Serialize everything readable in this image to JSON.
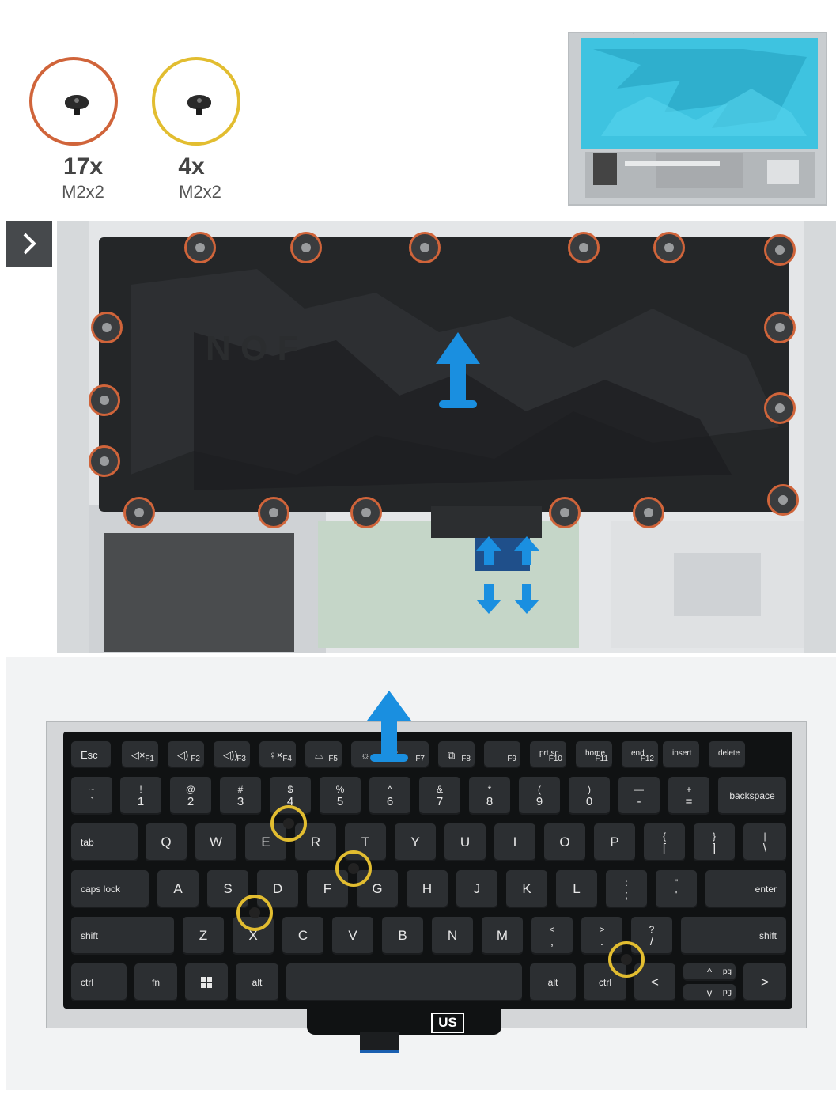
{
  "screws": [
    {
      "qty": "17x",
      "size": "M2x2",
      "ring_color": "#d0643a"
    },
    {
      "qty": "4x",
      "size": "M2x2",
      "ring_color": "#e2bd30"
    }
  ],
  "steps": [
    {
      "icon": "chevron-right-icon"
    },
    {
      "icon": "square-icon"
    }
  ],
  "plate_label": "US",
  "colors": {
    "arrow": "#1a8fe0",
    "orange_ring": "#d0643a",
    "yellow_ring": "#e2bd30",
    "badge": "#46494c"
  },
  "keyboard": {
    "row1": [
      {
        "t": "Esc",
        "f": "",
        "icon": ""
      },
      {
        "t": "",
        "f": "F1",
        "icon": "mute-icon"
      },
      {
        "t": "",
        "f": "F2",
        "icon": "volume-down-icon"
      },
      {
        "t": "",
        "f": "F3",
        "icon": "volume-up-icon"
      },
      {
        "t": "",
        "f": "F4",
        "icon": "mic-mute-icon"
      },
      {
        "t": "",
        "f": "F5",
        "icon": "backlight-icon"
      },
      {
        "t": "",
        "f": "F7",
        "icon": "brightness-icon"
      },
      {
        "t": "",
        "f": "F8",
        "icon": "display-switch-icon"
      },
      {
        "t": "",
        "f": "F9",
        "icon": ""
      },
      {
        "t": "prt sc",
        "f": "F10",
        "icon": ""
      },
      {
        "t": "home",
        "f": "F11",
        "icon": ""
      },
      {
        "t": "end",
        "f": "F12",
        "icon": ""
      },
      {
        "t": "insert",
        "f": "",
        "icon": ""
      },
      {
        "t": "delete",
        "f": "",
        "icon": ""
      }
    ],
    "row2": [
      {
        "t": "~",
        "b": "`"
      },
      {
        "t": "!",
        "b": "1"
      },
      {
        "t": "@",
        "b": "2"
      },
      {
        "t": "#",
        "b": "3"
      },
      {
        "t": "$",
        "b": "4"
      },
      {
        "t": "%",
        "b": "5"
      },
      {
        "t": "^",
        "b": "6"
      },
      {
        "t": "&",
        "b": "7"
      },
      {
        "t": "*",
        "b": "8"
      },
      {
        "t": "(",
        "b": "9"
      },
      {
        "t": ")",
        "b": "0"
      },
      {
        "t": "—",
        "b": "-"
      },
      {
        "t": "+",
        "b": "="
      }
    ],
    "backspace": "backspace",
    "tab": "tab",
    "row3": [
      "Q",
      "W",
      "E",
      "R",
      "T",
      "Y",
      "U",
      "I",
      "O",
      "P"
    ],
    "row3_sym": [
      {
        "t": "{",
        "b": "["
      },
      {
        "t": "}",
        "b": "]"
      },
      {
        "t": "|",
        "b": "\\"
      }
    ],
    "caps": "caps lock",
    "row4": [
      "A",
      "S",
      "D",
      "F",
      "G",
      "H",
      "J",
      "K",
      "L"
    ],
    "row4_sym": [
      {
        "t": ":",
        "b": ";"
      },
      {
        "t": "\"",
        "b": "'"
      }
    ],
    "enter": "enter",
    "shift_l": "shift",
    "row5": [
      "Z",
      "X",
      "C",
      "V",
      "B",
      "N",
      "M"
    ],
    "row5_sym": [
      {
        "t": "<",
        "b": ","
      },
      {
        "t": ">",
        "b": "."
      },
      {
        "t": "?",
        "b": "/"
      }
    ],
    "shift_r": "shift",
    "ctrl_l": "ctrl",
    "fn": "fn",
    "alt_l": "alt",
    "alt_r": "alt",
    "ctrl_r": "ctrl",
    "left_arrow": "<",
    "right_arrow": ">",
    "pg": "pg",
    "up_arrow": "^",
    "down_arrow": "v"
  }
}
